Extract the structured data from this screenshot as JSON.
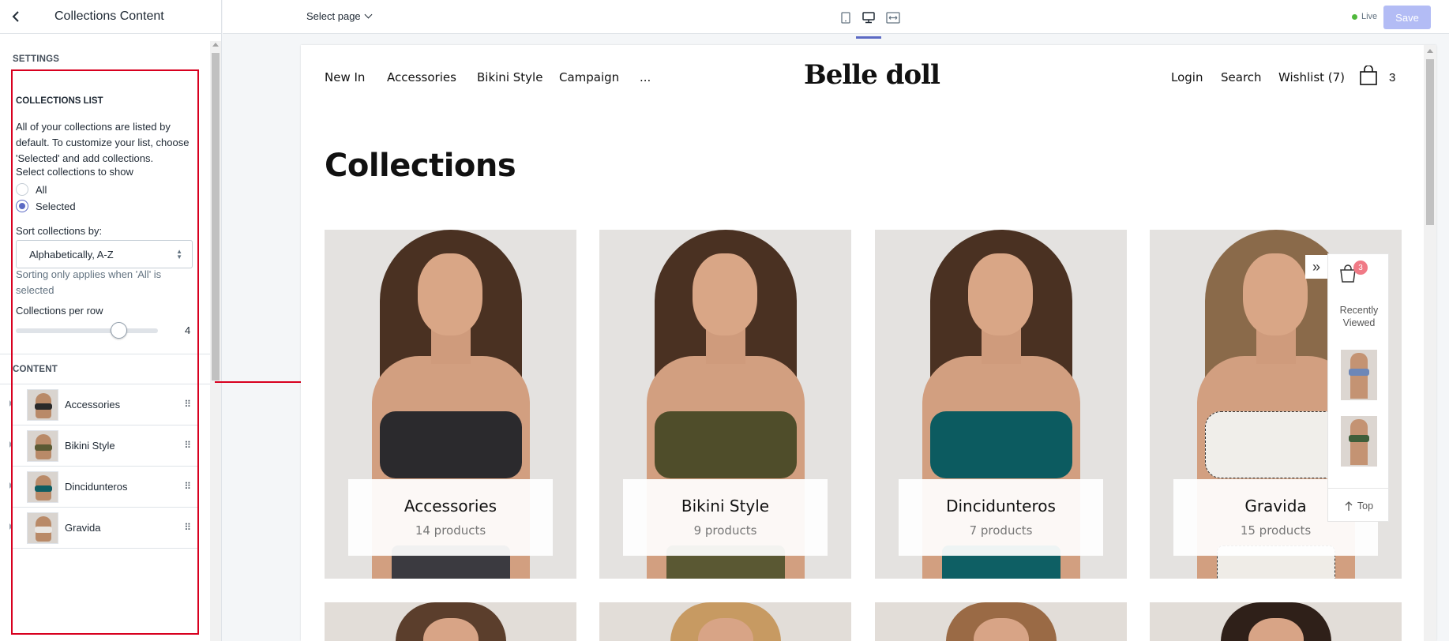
{
  "sidebar": {
    "title": "Collections Content",
    "settings_label": "SETTINGS",
    "collections_list": {
      "title": "COLLECTIONS LIST",
      "description": "All of your collections are listed by default. To customize your list, choose 'Selected' and add collections.",
      "select_label": "Select collections to show",
      "options": [
        "All",
        "Selected"
      ],
      "selected_option": "Selected",
      "sort_label": "Sort collections by:",
      "sort_value": "Alphabetically, A-Z",
      "sort_help": "Sorting only applies when 'All' is selected",
      "per_row_label": "Collections per row",
      "per_row_value": "4"
    },
    "content_label": "CONTENT",
    "content_items": [
      {
        "name": "Accessories",
        "swimwear_color": "#2a2a2a"
      },
      {
        "name": "Bikini Style",
        "swimwear_color": "#5b5a34"
      },
      {
        "name": "Dincidunteros",
        "swimwear_color": "#0f5e63"
      },
      {
        "name": "Gravida",
        "swimwear_color": "#e9e6e2"
      }
    ]
  },
  "topbar": {
    "select_page": "Select page",
    "views": [
      "mobile-view-icon",
      "desktop-view-icon",
      "fullwidth-view-icon"
    ],
    "active_view": "desktop",
    "live_label": "Live",
    "save_label": "Save",
    "accent_color": "#5c6ac4"
  },
  "store": {
    "nav_left": [
      "New In",
      "Accessories",
      "Bikini Style",
      "Campaign",
      "..."
    ],
    "logo": "Belle doll",
    "nav_right": [
      "Login",
      "Search",
      "Wishlist (7)"
    ],
    "cart_count": "3",
    "heading": "Collections",
    "collections": [
      {
        "title": "Accessories",
        "count": "14 products",
        "top_color": "#2b2a2d",
        "bottom_color": "#3b3a40",
        "bg": "#e6e4e2"
      },
      {
        "title": "Bikini Style",
        "count": "9 products",
        "top_color": "#4f4d2a",
        "bottom_color": "#5a5833",
        "bg": "#e9e6e3"
      },
      {
        "title": "Dincidunteros",
        "count": "7 products",
        "top_color": "#0c5b60",
        "bottom_color": "#0e5f64",
        "bg": "#e7e5e3"
      },
      {
        "title": "Gravida",
        "count": "15 products",
        "top_color": "#f0eeea",
        "bottom_color": "#efece7",
        "bg": "#e8e6e4"
      }
    ],
    "recently_viewed": {
      "badge": "3",
      "title": "Recently Viewed",
      "thumb_colors": [
        "#6d87b8",
        "#3f5e3a"
      ],
      "top_label": "Top"
    }
  }
}
